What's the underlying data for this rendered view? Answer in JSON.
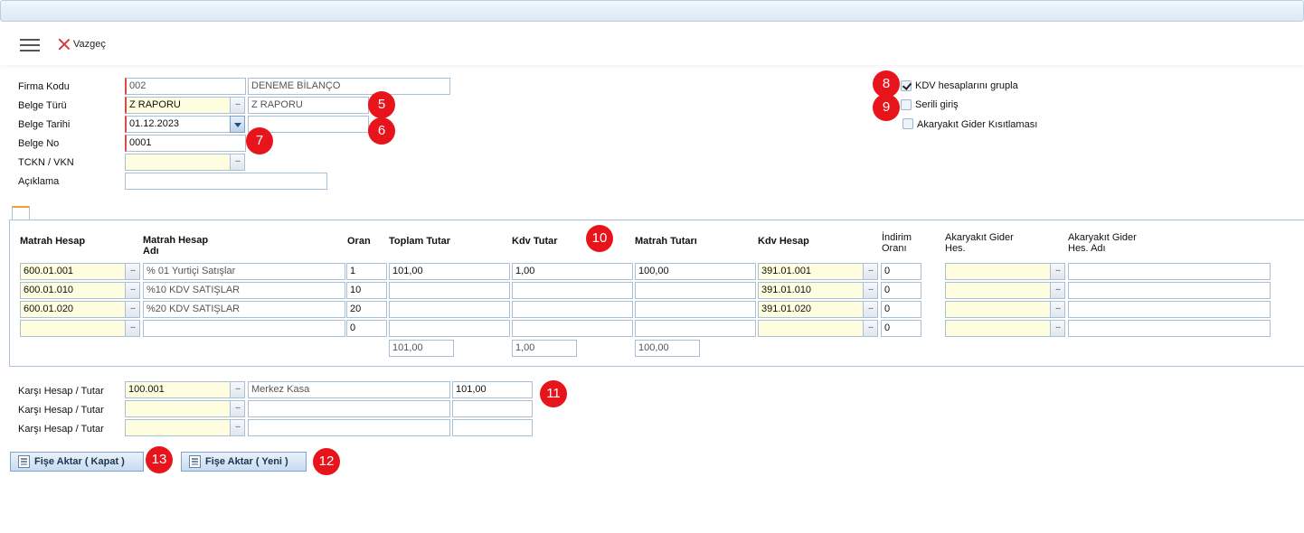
{
  "toolbar": {
    "cancel_label": "Vazgeç"
  },
  "header": {
    "firma_kodu_label": "Firma Kodu",
    "firma_kodu": "002",
    "firma_adi": "DENEME BİLANÇO",
    "belge_turu_label": "Belge Türü",
    "belge_turu": "Z RAPORU",
    "belge_turu_adi": "Z RAPORU",
    "belge_tarihi_label": "Belge Tarihi",
    "belge_tarihi": "01.12.2023",
    "belge_tarihi_extra": "",
    "belge_no_label": "Belge No",
    "belge_no": "0001",
    "tckn_label": "TCKN / VKN",
    "tckn": "",
    "aciklama_label": "Açıklama",
    "aciklama": ""
  },
  "options": {
    "kdv_group_label": "KDV hesaplarını grupla",
    "kdv_group_checked": true,
    "serili_label": "Serili giriş",
    "serili_checked": false,
    "akaryakit_label": "Akaryakıt Gider Kısıtlaması",
    "akaryakit_checked": false
  },
  "badges": [
    "5",
    "6",
    "7",
    "8",
    "9",
    "10",
    "11",
    "12",
    "13"
  ],
  "grid": {
    "columns": {
      "matrah_hesap": "Matrah Hesap",
      "matrah_hesap_adi_1": "Matrah Hesap",
      "matrah_hesap_adi_2": "Adı",
      "oran": "Oran",
      "toplam_tutar": "Toplam Tutar",
      "kdv_tutar": "Kdv Tutar",
      "matrah_tutari": "Matrah Tutarı",
      "kdv_hesap": "Kdv Hesap",
      "indirim_orani_1": "İndirim",
      "indirim_orani_2": "Oranı",
      "akaryakit_hes_1": "Akaryakıt Gider",
      "akaryakit_hes_2": "Hes.",
      "akaryakit_adi_1": "Akaryakıt Gider",
      "akaryakit_adi_2": "Hes. Adı"
    },
    "rows": [
      {
        "matrah_hesap": "600.01.001",
        "matrah_adi": "% 01 Yurtiçi Satışlar",
        "oran": "1",
        "toplam": "101,00",
        "kdv": "1,00",
        "matrah_tutari": "100,00",
        "kdv_hesap": "391.01.001",
        "indirim": "0",
        "akaryakit_hes": "",
        "akaryakit_adi": ""
      },
      {
        "matrah_hesap": "600.01.010",
        "matrah_adi": "%10 KDV SATIŞLAR",
        "oran": "10",
        "toplam": "",
        "kdv": "",
        "matrah_tutari": "",
        "kdv_hesap": "391.01.010",
        "indirim": "0",
        "akaryakit_hes": "",
        "akaryakit_adi": ""
      },
      {
        "matrah_hesap": "600.01.020",
        "matrah_adi": "%20 KDV SATIŞLAR",
        "oran": "20",
        "toplam": "",
        "kdv": "",
        "matrah_tutari": "",
        "kdv_hesap": "391.01.020",
        "indirim": "0",
        "akaryakit_hes": "",
        "akaryakit_adi": ""
      },
      {
        "matrah_hesap": "",
        "matrah_adi": "",
        "oran": "0",
        "toplam": "",
        "kdv": "",
        "matrah_tutari": "",
        "kdv_hesap": "",
        "indirim": "0",
        "akaryakit_hes": "",
        "akaryakit_adi": ""
      }
    ],
    "totals": {
      "toplam": "101,00",
      "kdv": "1,00",
      "matrah": "100,00"
    }
  },
  "karsi": [
    {
      "label": "Karşı Hesap / Tutar",
      "hesap": "100.001",
      "adi": "Merkez Kasa",
      "tutar": "101,00"
    },
    {
      "label": "Karşı Hesap / Tutar",
      "hesap": "",
      "adi": "",
      "tutar": ""
    },
    {
      "label": "Karşı Hesap / Tutar",
      "hesap": "",
      "adi": "",
      "tutar": ""
    }
  ],
  "buttons": {
    "fise_aktar_kapat": "Fişe Aktar ( Kapat )",
    "fise_aktar_yeni": "Fişe Aktar ( Yeni )"
  }
}
